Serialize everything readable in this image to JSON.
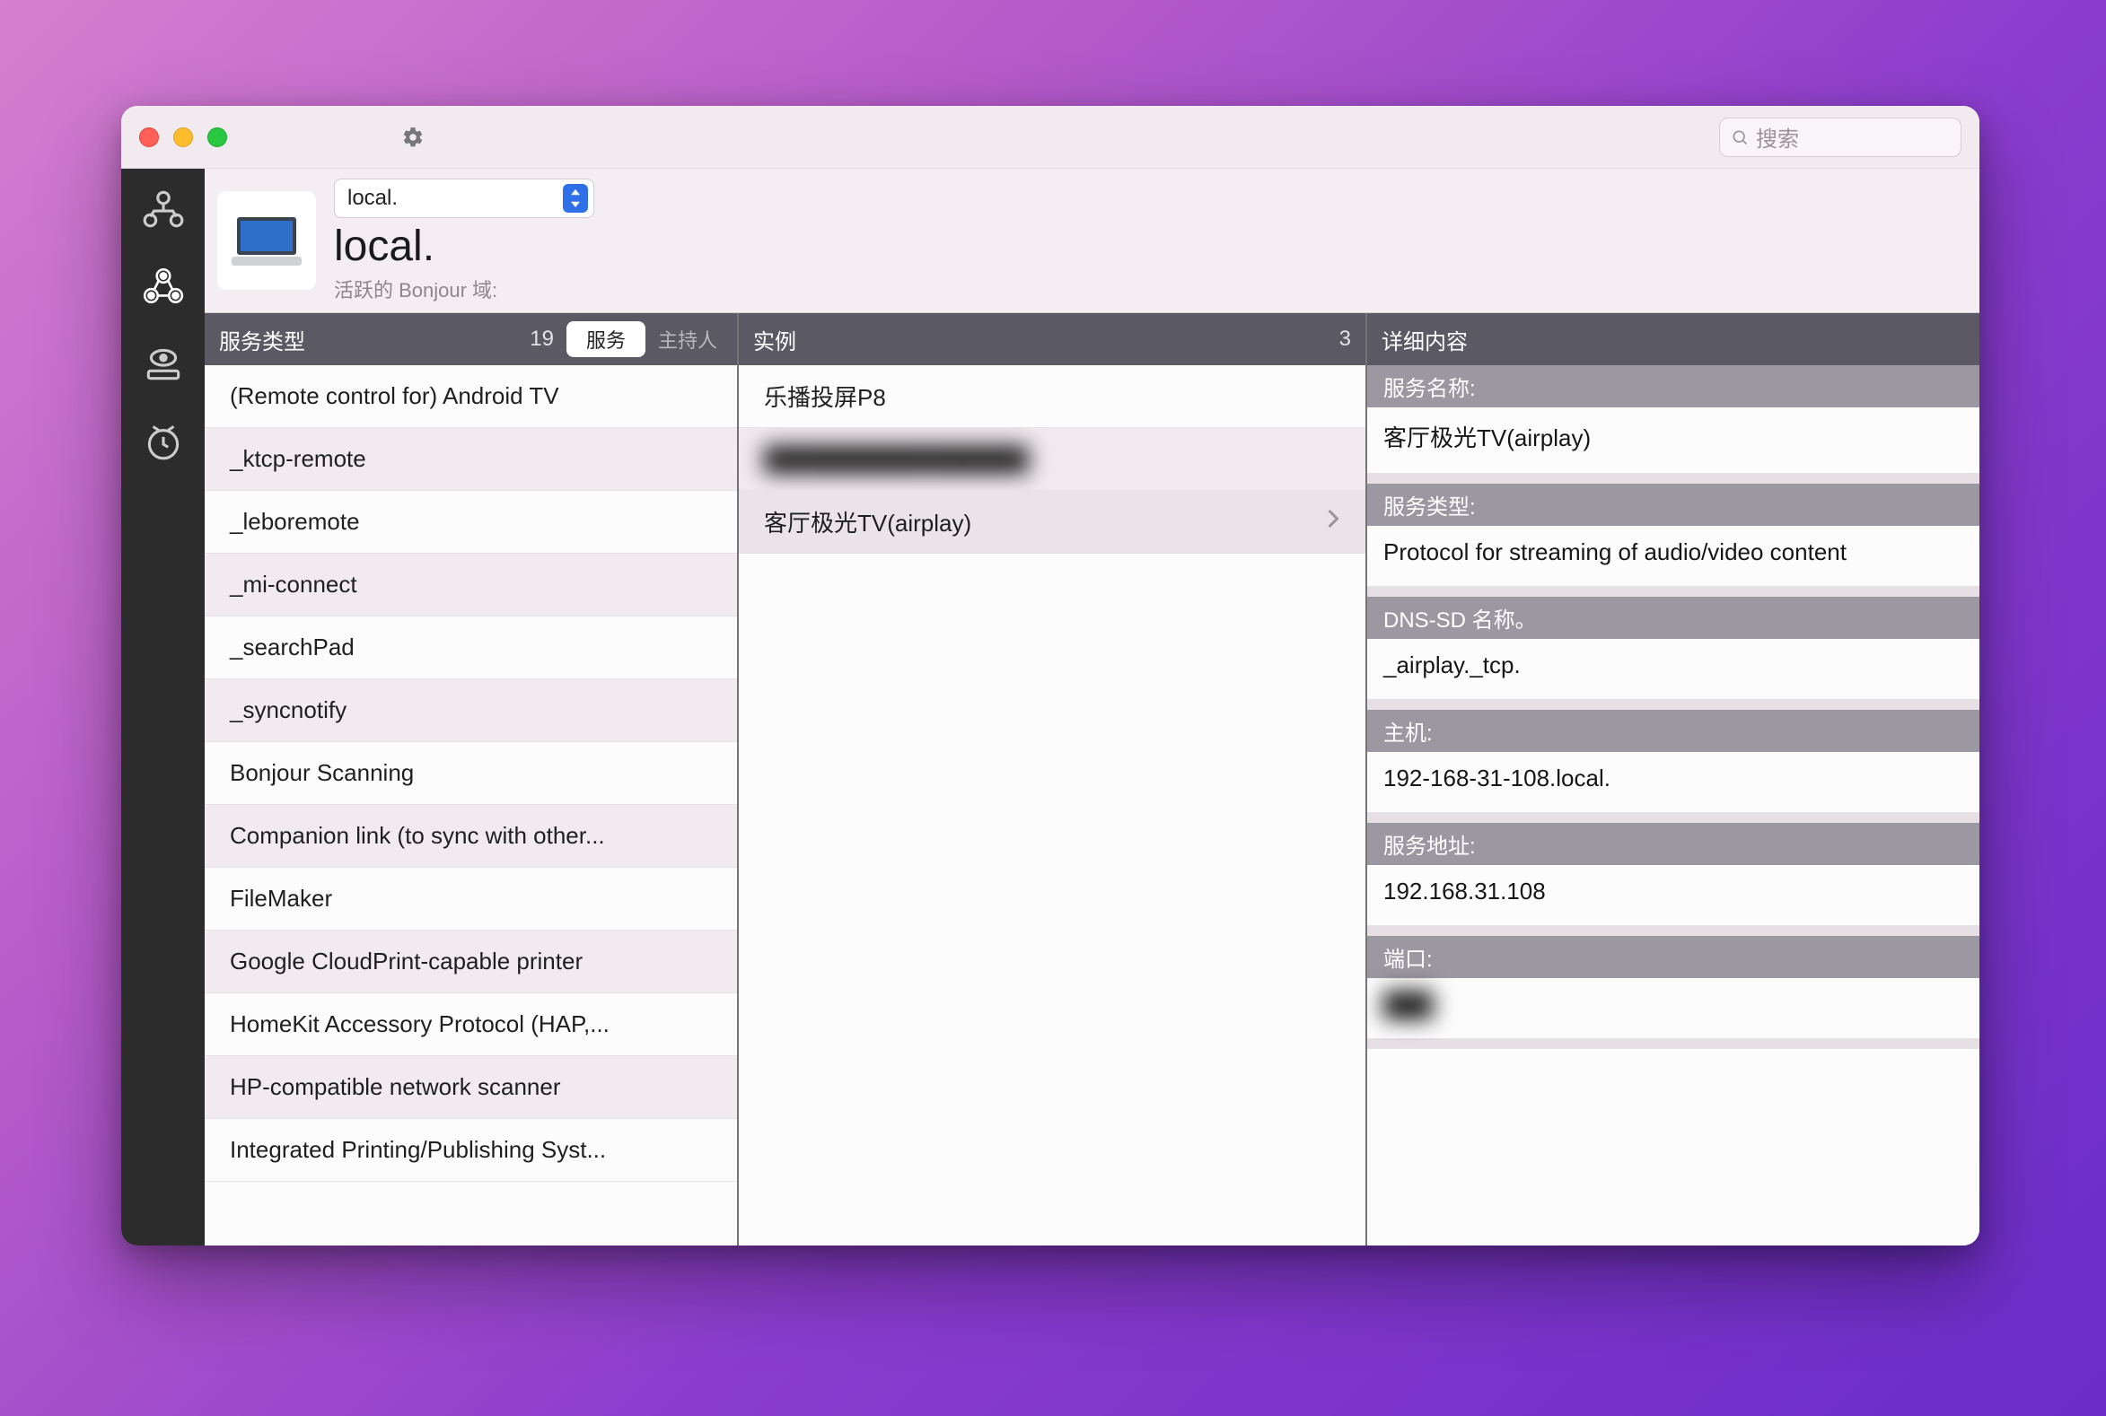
{
  "search_placeholder": "搜索",
  "domain": {
    "selected": "local.",
    "title": "local.",
    "subtitle": "活跃的 Bonjour 域:"
  },
  "services_header": {
    "label": "服务类型",
    "count": "19",
    "seg_service": "服务",
    "seg_host": "主持人"
  },
  "services": [
    "(Remote control for) Android TV",
    "_ktcp-remote",
    "_leboremote",
    "_mi-connect",
    "_searchPad",
    "_syncnotify",
    "Bonjour Scanning",
    "Companion link (to sync with other...",
    "FileMaker",
    "Google CloudPrint-capable printer",
    "HomeKit Accessory Protocol (HAP,...",
    "HP-compatible network scanner",
    "Integrated Printing/Publishing Syst..."
  ],
  "instances_header": {
    "label": "实例",
    "count": "3"
  },
  "instances": [
    {
      "label": "乐播投屏P8",
      "blurred": false,
      "selected": false
    },
    {
      "label": "████████████████",
      "blurred": true,
      "selected": false
    },
    {
      "label": "客厅极光TV(airplay)",
      "blurred": false,
      "selected": true
    }
  ],
  "details_header": "详细内容",
  "details": [
    {
      "label": "服务名称:",
      "value": "客厅极光TV(airplay)"
    },
    {
      "label": "服务类型:",
      "value": "Protocol for streaming of audio/video content"
    },
    {
      "label": "DNS-SD 名称。",
      "value": "_airplay._tcp."
    },
    {
      "label": "主机:",
      "value": "192-168-31-108.local."
    },
    {
      "label": "服务地址:",
      "value": "192.168.31.108"
    },
    {
      "label": "端口:",
      "value": "███",
      "blurred": true
    }
  ]
}
